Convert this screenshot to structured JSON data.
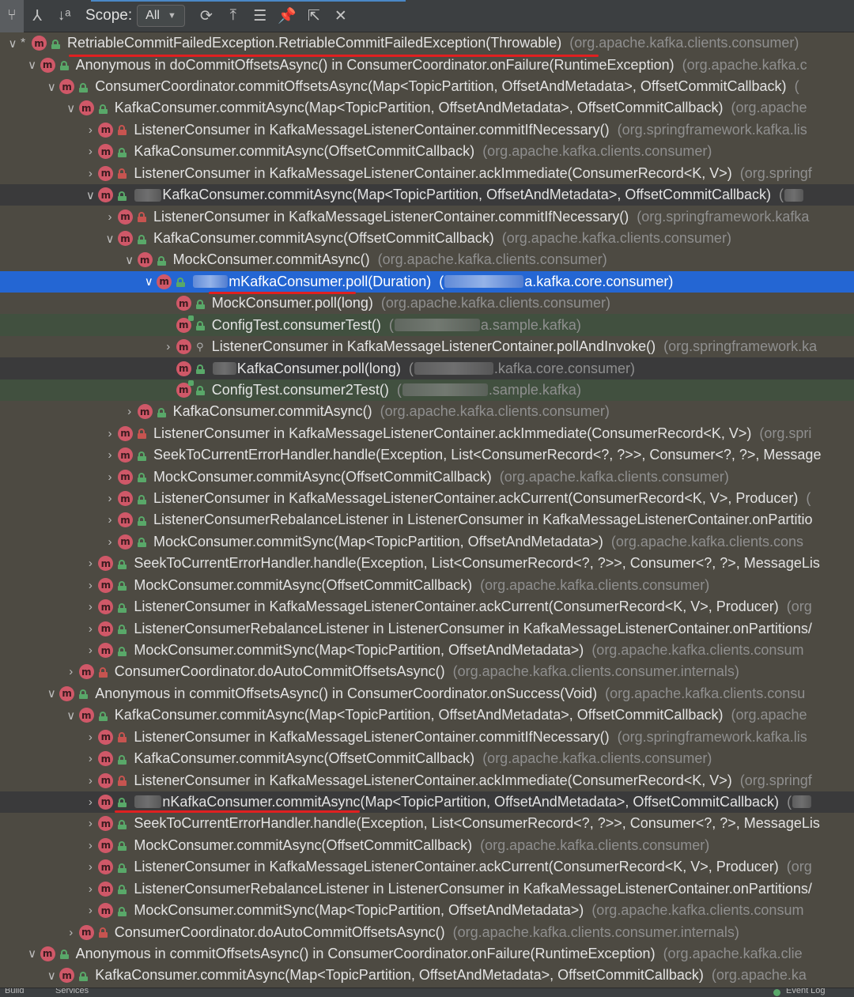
{
  "toolbar": {
    "scope_label": "Scope:",
    "scope_value": "All"
  },
  "statusbar": {
    "left_text": "Build",
    "left_text2": "Services",
    "right_text": "Event Log"
  },
  "tree": [
    {
      "indent": 0,
      "arrow": "∨",
      "mark": "*",
      "icon": "m",
      "vis": "public",
      "sig": "RetriableCommitFailedException.RetriableCommitFailedException(Throwable)",
      "pkg": "(org.apache.kafka.clients.consumer)"
    },
    {
      "indent": 1,
      "arrow": "∨",
      "icon": "m",
      "vis": "public",
      "sig": "Anonymous in doCommitOffsetsAsync() in ConsumerCoordinator.onFailure(RuntimeException)",
      "pkg": "(org.apache.kafka.c"
    },
    {
      "indent": 2,
      "arrow": "∨",
      "icon": "m",
      "vis": "public",
      "sig": "ConsumerCoordinator.commitOffsetsAsync(Map<TopicPartition, OffsetAndMetadata>, OffsetCommitCallback)",
      "pkg": "("
    },
    {
      "indent": 3,
      "arrow": "∨",
      "icon": "m",
      "vis": "public",
      "sig": "KafkaConsumer.commitAsync(Map<TopicPartition, OffsetAndMetadata>, OffsetCommitCallback)",
      "pkg": "(org.apache"
    },
    {
      "indent": 4,
      "arrow": "›",
      "icon": "m",
      "vis": "private",
      "sig": "ListenerConsumer in KafkaMessageListenerContainer.commitIfNecessary()",
      "pkg": "(org.springframework.kafka.lis"
    },
    {
      "indent": 4,
      "arrow": "›",
      "icon": "m",
      "vis": "public",
      "sig": "KafkaConsumer.commitAsync(OffsetCommitCallback)",
      "pkg": "(org.apache.kafka.clients.consumer)"
    },
    {
      "indent": 4,
      "arrow": "›",
      "icon": "m",
      "vis": "private",
      "sig": "ListenerConsumer in KafkaMessageListenerContainer.ackImmediate(ConsumerRecord<K, V>)",
      "pkg": "(org.springf"
    },
    {
      "indent": 4,
      "arrow": "∨",
      "icon": "m",
      "vis": "public",
      "style": "dark",
      "blurPre": 34,
      "sig": "KafkaConsumer.commitAsync(Map<TopicPartition, OffsetAndMetadata>, OffsetCommitCallback)",
      "pkg": "(",
      "blurPost": 24
    },
    {
      "indent": 5,
      "arrow": "›",
      "icon": "m",
      "vis": "private",
      "sig": "ListenerConsumer in KafkaMessageListenerContainer.commitIfNecessary()",
      "pkg": "(org.springframework.kafka"
    },
    {
      "indent": 5,
      "arrow": "∨",
      "icon": "m",
      "vis": "public",
      "sig": "KafkaConsumer.commitAsync(OffsetCommitCallback)",
      "pkg": "(org.apache.kafka.clients.consumer)"
    },
    {
      "indent": 6,
      "arrow": "∨",
      "icon": "m",
      "vis": "public",
      "sig": "MockConsumer.commitAsync()",
      "pkg": "(org.apache.kafka.clients.consumer)"
    },
    {
      "indent": 7,
      "arrow": "∨",
      "icon": "m",
      "vis": "public",
      "style": "selected",
      "blurPre": 44,
      "sig": "mKafkaConsumer.poll(Duration)",
      "pkg": "(",
      "blurMid": 100,
      "pkgTail": "a.kafka.core.consumer)"
    },
    {
      "indent": 8,
      "arrow": "",
      "icon": "m",
      "vis": "public",
      "sig": "MockConsumer.poll(long)",
      "pkg": "(org.apache.kafka.clients.consumer)"
    },
    {
      "indent": 8,
      "arrow": "",
      "icon": "m",
      "test": true,
      "vis": "public",
      "style": "green",
      "sig": "ConfigTest.consumerTest()",
      "pkg": "(",
      "blurMid": 108,
      "pkgTail": "a.sample.kafka)"
    },
    {
      "indent": 8,
      "arrow": "›",
      "icon": "m",
      "vis": "package",
      "sig": "ListenerConsumer in KafkaMessageListenerContainer.pollAndInvoke()",
      "pkg": "(org.springframework.ka"
    },
    {
      "indent": 8,
      "arrow": "",
      "icon": "m",
      "vis": "public",
      "style": "dark",
      "blurPre": 30,
      "sig": "KafkaConsumer.poll(long)",
      "pkg": "(",
      "blurMid": 100,
      "pkgTail": ".kafka.core.consumer)"
    },
    {
      "indent": 8,
      "arrow": "",
      "icon": "m",
      "test": true,
      "vis": "public",
      "style": "green",
      "sig": "ConfigTest.consumer2Test()",
      "pkg": "(",
      "blurMid": 108,
      "pkgTail": ".sample.kafka)"
    },
    {
      "indent": 6,
      "arrow": "›",
      "icon": "m",
      "vis": "public",
      "sig": "KafkaConsumer.commitAsync()",
      "pkg": "(org.apache.kafka.clients.consumer)"
    },
    {
      "indent": 5,
      "arrow": "›",
      "icon": "m",
      "vis": "private",
      "sig": "ListenerConsumer in KafkaMessageListenerContainer.ackImmediate(ConsumerRecord<K, V>)",
      "pkg": "(org.spri"
    },
    {
      "indent": 5,
      "arrow": "›",
      "icon": "m",
      "vis": "public",
      "sig": "SeekToCurrentErrorHandler.handle(Exception, List<ConsumerRecord<?, ?>>, Consumer<?, ?>, Message",
      "pkg": ""
    },
    {
      "indent": 5,
      "arrow": "›",
      "icon": "m",
      "vis": "public",
      "sig": "MockConsumer.commitAsync(OffsetCommitCallback)",
      "pkg": "(org.apache.kafka.clients.consumer)"
    },
    {
      "indent": 5,
      "arrow": "›",
      "icon": "m",
      "vis": "public",
      "sig": "ListenerConsumer in KafkaMessageListenerContainer.ackCurrent(ConsumerRecord<K, V>, Producer)",
      "pkg": "("
    },
    {
      "indent": 5,
      "arrow": "›",
      "icon": "m",
      "vis": "public",
      "sig": "ListenerConsumerRebalanceListener in ListenerConsumer in KafkaMessageListenerContainer.onPartitio",
      "pkg": ""
    },
    {
      "indent": 5,
      "arrow": "›",
      "icon": "m",
      "vis": "public",
      "sig": "MockConsumer.commitSync(Map<TopicPartition, OffsetAndMetadata>)",
      "pkg": "(org.apache.kafka.clients.cons"
    },
    {
      "indent": 4,
      "arrow": "›",
      "icon": "m",
      "vis": "public",
      "sig": "SeekToCurrentErrorHandler.handle(Exception, List<ConsumerRecord<?, ?>>, Consumer<?, ?>, MessageLis",
      "pkg": ""
    },
    {
      "indent": 4,
      "arrow": "›",
      "icon": "m",
      "vis": "public",
      "sig": "MockConsumer.commitAsync(OffsetCommitCallback)",
      "pkg": "(org.apache.kafka.clients.consumer)"
    },
    {
      "indent": 4,
      "arrow": "›",
      "icon": "m",
      "vis": "public",
      "sig": "ListenerConsumer in KafkaMessageListenerContainer.ackCurrent(ConsumerRecord<K, V>, Producer)",
      "pkg": "(org"
    },
    {
      "indent": 4,
      "arrow": "›",
      "icon": "m",
      "vis": "public",
      "sig": "ListenerConsumerRebalanceListener in ListenerConsumer in KafkaMessageListenerContainer.onPartitions/",
      "pkg": ""
    },
    {
      "indent": 4,
      "arrow": "›",
      "icon": "m",
      "vis": "public",
      "sig": "MockConsumer.commitSync(Map<TopicPartition, OffsetAndMetadata>)",
      "pkg": "(org.apache.kafka.clients.consum"
    },
    {
      "indent": 3,
      "arrow": "›",
      "icon": "m",
      "vis": "private",
      "sig": "ConsumerCoordinator.doAutoCommitOffsetsAsync()",
      "pkg": "(org.apache.kafka.clients.consumer.internals)"
    },
    {
      "indent": 2,
      "arrow": "∨",
      "icon": "m",
      "vis": "public",
      "sig": "Anonymous in commitOffsetsAsync() in ConsumerCoordinator.onSuccess(Void)",
      "pkg": "(org.apache.kafka.clients.consu"
    },
    {
      "indent": 3,
      "arrow": "∨",
      "icon": "m",
      "vis": "public",
      "sig": "KafkaConsumer.commitAsync(Map<TopicPartition, OffsetAndMetadata>, OffsetCommitCallback)",
      "pkg": "(org.apache"
    },
    {
      "indent": 4,
      "arrow": "›",
      "icon": "m",
      "vis": "private",
      "sig": "ListenerConsumer in KafkaMessageListenerContainer.commitIfNecessary()",
      "pkg": "(org.springframework.kafka.lis"
    },
    {
      "indent": 4,
      "arrow": "›",
      "icon": "m",
      "vis": "public",
      "sig": "KafkaConsumer.commitAsync(OffsetCommitCallback)",
      "pkg": "(org.apache.kafka.clients.consumer)"
    },
    {
      "indent": 4,
      "arrow": "›",
      "icon": "m",
      "vis": "private",
      "sig": "ListenerConsumer in KafkaMessageListenerContainer.ackImmediate(ConsumerRecord<K, V>)",
      "pkg": "(org.springf"
    },
    {
      "indent": 4,
      "arrow": "›",
      "icon": "m",
      "vis": "public",
      "style": "dark",
      "blurPre": 34,
      "sig": "nKafkaConsumer.commitAsync(Map<TopicPartition, OffsetAndMetadata>, OffsetCommitCallback)",
      "pkg": "(",
      "blurPost": 24
    },
    {
      "indent": 4,
      "arrow": "›",
      "icon": "m",
      "vis": "public",
      "sig": "SeekToCurrentErrorHandler.handle(Exception, List<ConsumerRecord<?, ?>>, Consumer<?, ?>, MessageLis",
      "pkg": ""
    },
    {
      "indent": 4,
      "arrow": "›",
      "icon": "m",
      "vis": "public",
      "sig": "MockConsumer.commitAsync(OffsetCommitCallback)",
      "pkg": "(org.apache.kafka.clients.consumer)"
    },
    {
      "indent": 4,
      "arrow": "›",
      "icon": "m",
      "vis": "public",
      "sig": "ListenerConsumer in KafkaMessageListenerContainer.ackCurrent(ConsumerRecord<K, V>, Producer)",
      "pkg": "(org"
    },
    {
      "indent": 4,
      "arrow": "›",
      "icon": "m",
      "vis": "public",
      "sig": "ListenerConsumerRebalanceListener in ListenerConsumer in KafkaMessageListenerContainer.onPartitions/",
      "pkg": ""
    },
    {
      "indent": 4,
      "arrow": "›",
      "icon": "m",
      "vis": "public",
      "sig": "MockConsumer.commitSync(Map<TopicPartition, OffsetAndMetadata>)",
      "pkg": "(org.apache.kafka.clients.consum"
    },
    {
      "indent": 3,
      "arrow": "›",
      "icon": "m",
      "vis": "private",
      "sig": "ConsumerCoordinator.doAutoCommitOffsetsAsync()",
      "pkg": "(org.apache.kafka.clients.consumer.internals)"
    },
    {
      "indent": 1,
      "arrow": "∨",
      "icon": "m",
      "vis": "public",
      "sig": "Anonymous in commitOffsetsAsync() in ConsumerCoordinator.onFailure(RuntimeException)",
      "pkg": "(org.apache.kafka.clie"
    },
    {
      "indent": 2,
      "arrow": "∨",
      "icon": "m",
      "vis": "public",
      "sig": "KafkaConsumer.commitAsync(Map<TopicPartition, OffsetAndMetadata>, OffsetCommitCallback)",
      "pkg": "(org.apache.ka"
    }
  ]
}
